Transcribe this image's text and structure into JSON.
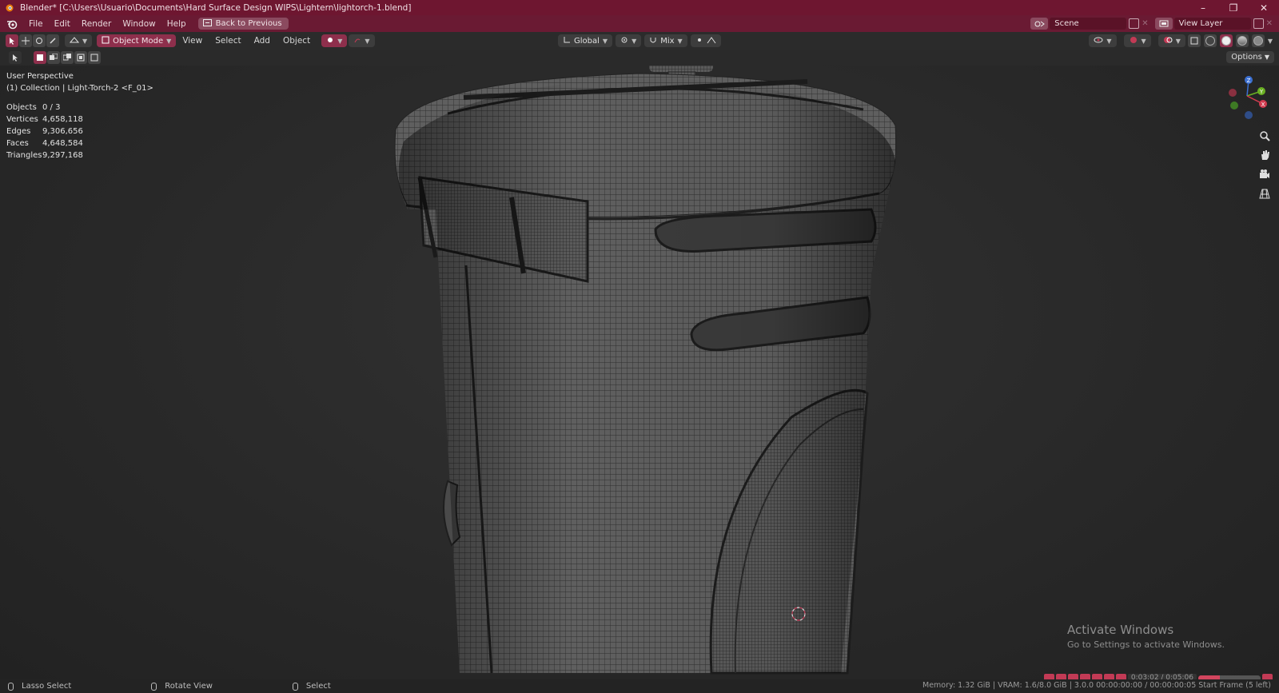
{
  "window": {
    "title": "Blender* [C:\\Users\\Usuario\\Documents\\Hard Surface Design WIPS\\Lightern\\lightorch-1.blend]",
    "controls": [
      "–",
      "❐",
      "✕"
    ]
  },
  "menubar": {
    "items": [
      "File",
      "Edit",
      "Render",
      "Window",
      "Help"
    ],
    "back_button": "Back to Previous",
    "scene_label": "Scene",
    "view_layer_label": "View Layer"
  },
  "header": {
    "mode": "Object Mode",
    "menus": [
      "View",
      "Select",
      "Add",
      "Object"
    ],
    "transform_orientation": "Global",
    "snap_mode": "Mix",
    "options_label": "Options"
  },
  "viewport": {
    "perspective": "User Perspective",
    "collection": "(1) Collection | Light-Torch-2 <F_01>",
    "stats": [
      {
        "label": "Objects",
        "value": "0 / 3"
      },
      {
        "label": "Vertices",
        "value": "4,658,118"
      },
      {
        "label": "Edges",
        "value": "9,306,656"
      },
      {
        "label": "Faces",
        "value": "4,648,584"
      },
      {
        "label": "Triangles",
        "value": "9,297,168"
      }
    ],
    "gizmo_axes": {
      "x": "X",
      "y": "Y",
      "z": "Z"
    },
    "activate_title": "Activate Windows",
    "activate_sub": "Go to Settings to activate Windows."
  },
  "timeline": {
    "time": "0:03:02 / 0:05:06",
    "progress": 0.35
  },
  "statusbar": {
    "lasso": "Lasso Select",
    "rotate": "Rotate View",
    "select": "Select",
    "right": "Memory: 1.32 GiB | VRAM: 1.6/8.0 GiB | 3.0.0   00:00:00:00 / 00:00:00:05   Start Frame (5 left)"
  },
  "colors": {
    "accent": "#8e2f4c",
    "titlebar": "#6e1630",
    "menubar": "#6a1a33"
  }
}
